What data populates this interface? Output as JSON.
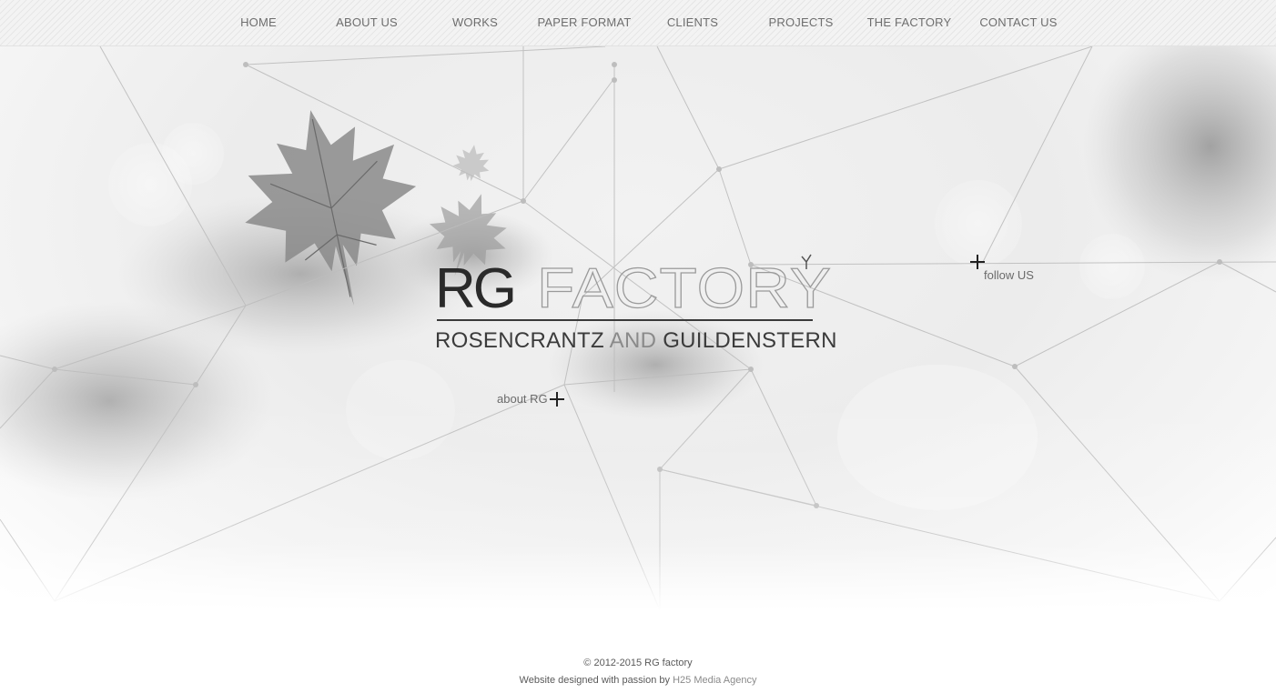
{
  "nav": {
    "items": [
      {
        "label": "HOME"
      },
      {
        "label": "ABOUT US"
      },
      {
        "label": "WORKS"
      },
      {
        "label": "PAPER FORMAT"
      },
      {
        "label": "CLIENTS"
      },
      {
        "label": "PROJECTS"
      },
      {
        "label": "THE FACTORY"
      },
      {
        "label": "CONTACT US"
      }
    ]
  },
  "logo": {
    "brand_rg": "RG",
    "brand_factory": "FACTORY",
    "subtitle_part1": "ROSENCRANTZ",
    "subtitle_part2": "AND",
    "subtitle_part3": "GUILDENSTERN"
  },
  "links": {
    "follow_label": "follow US",
    "about_label": "about RG"
  },
  "footer": {
    "copyright": "© 2012-2015 RG factory",
    "designed_prefix": "Website designed with passion by",
    "agency_link": "H25 Media Agency"
  },
  "colors": {
    "accent_dark": "#222222",
    "text_gray": "#6e6e6e",
    "nav_bg": "#f3f3f3"
  }
}
